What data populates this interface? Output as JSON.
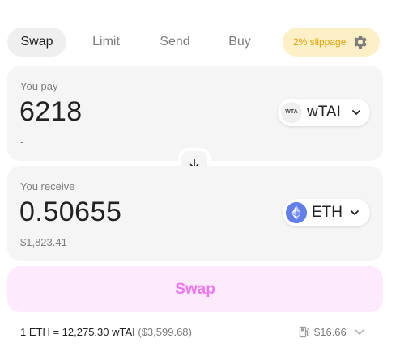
{
  "tabs": [
    {
      "label": "Swap",
      "active": true
    },
    {
      "label": "Limit",
      "active": false
    },
    {
      "label": "Send",
      "active": false
    },
    {
      "label": "Buy",
      "active": false
    }
  ],
  "slippage": {
    "label": "2% slippage",
    "icon": "gear-icon",
    "color": "#e2a20a",
    "background": "#fdf0c6"
  },
  "pay": {
    "label": "You pay",
    "amount": "6218",
    "fiat": "-",
    "token": {
      "logo_text": "WTA",
      "symbol": "wTAI",
      "icon": "chevron-down-icon"
    }
  },
  "switch": {
    "icon": "arrow-down-icon"
  },
  "receive": {
    "label": "You receive",
    "amount": "0.50655",
    "fiat": "$1,823.41",
    "token": {
      "symbol": "ETH",
      "icon": "eth-logo-icon",
      "color": "#627eea"
    }
  },
  "swap_button": {
    "label": "Swap",
    "text_color": "#ef78ef",
    "background": "#fdeafd"
  },
  "footer": {
    "rate": "1 ETH = 12,275.30 wTAI",
    "rate_usd": "($3,599.68)",
    "gas_icon": "gas-pump-icon",
    "gas": "$16.66"
  }
}
